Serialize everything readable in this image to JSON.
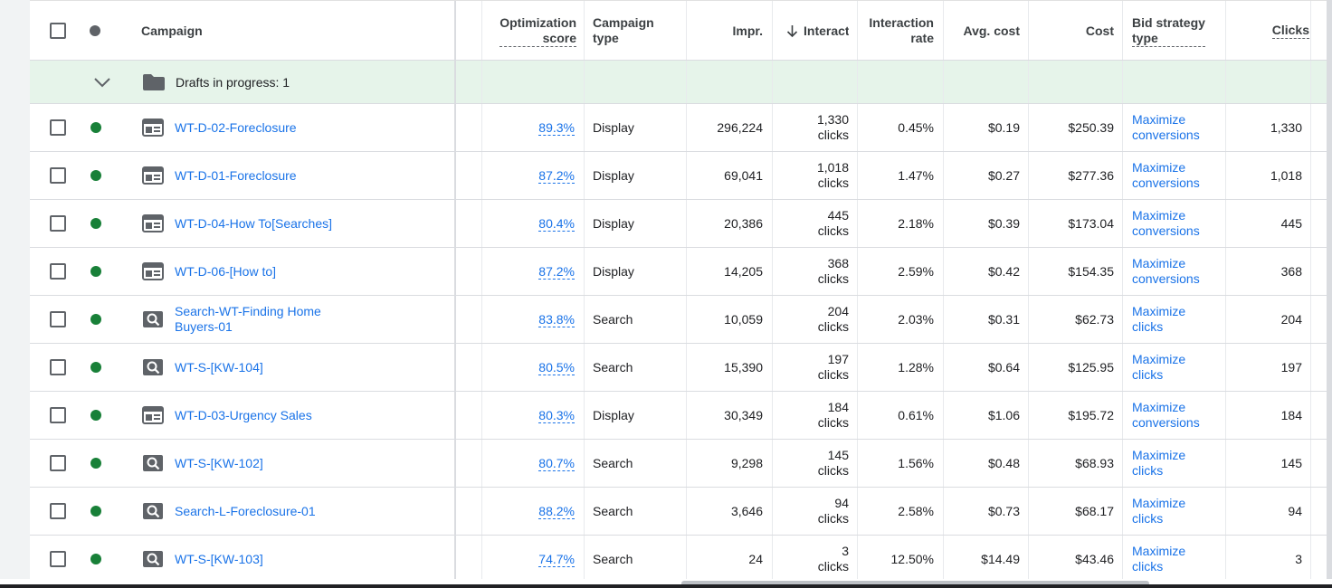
{
  "header": {
    "campaign": "Campaign",
    "opt_score_1": "Optimization",
    "opt_score_2": "score",
    "campaign_type_1": "Campaign",
    "campaign_type_2": "type",
    "impr": "Impr.",
    "interactions": "Interact",
    "interaction_rate_1": "Interaction",
    "interaction_rate_2": "rate",
    "avg_cost": "Avg. cost",
    "cost": "Cost",
    "bid_strategy_1": "Bid strategy",
    "bid_strategy_2": "type",
    "clicks": "Clicks"
  },
  "draft": {
    "label": "Drafts in progress: 1"
  },
  "colors": {
    "status_enabled": "#188038",
    "link": "#1a73e8",
    "draft_bg": "#e6f4ea"
  },
  "rows": [
    {
      "icon": "display-campaign-icon",
      "name": "WT-D-02-Foreclosure",
      "score": "89.3%",
      "type": "Display",
      "impr": "296,224",
      "inter_1": "1,330",
      "inter_2": "clicks",
      "rate": "0.45%",
      "avg": "$0.19",
      "cost": "$250.39",
      "bid_1": "Maximize",
      "bid_2": "conversions",
      "clicks": "1,330"
    },
    {
      "icon": "display-campaign-icon",
      "name": "WT-D-01-Foreclosure",
      "score": "87.2%",
      "type": "Display",
      "impr": "69,041",
      "inter_1": "1,018",
      "inter_2": "clicks",
      "rate": "1.47%",
      "avg": "$0.27",
      "cost": "$277.36",
      "bid_1": "Maximize",
      "bid_2": "conversions",
      "clicks": "1,018"
    },
    {
      "icon": "display-campaign-icon",
      "name": "WT-D-04-How To[Searches]",
      "score": "80.4%",
      "type": "Display",
      "impr": "20,386",
      "inter_1": "445",
      "inter_2": "clicks",
      "rate": "2.18%",
      "avg": "$0.39",
      "cost": "$173.04",
      "bid_1": "Maximize",
      "bid_2": "conversions",
      "clicks": "445"
    },
    {
      "icon": "display-campaign-icon",
      "name": "WT-D-06-[How to]",
      "score": "87.2%",
      "type": "Display",
      "impr": "14,205",
      "inter_1": "368",
      "inter_2": "clicks",
      "rate": "2.59%",
      "avg": "$0.42",
      "cost": "$154.35",
      "bid_1": "Maximize",
      "bid_2": "conversions",
      "clicks": "368"
    },
    {
      "icon": "search-campaign-icon",
      "name": "Search-WT-Finding Home",
      "name_2": "Buyers-01",
      "score": "83.8%",
      "type": "Search",
      "impr": "10,059",
      "inter_1": "204",
      "inter_2": "clicks",
      "rate": "2.03%",
      "avg": "$0.31",
      "cost": "$62.73",
      "bid_1": "Maximize",
      "bid_2": "clicks",
      "clicks": "204"
    },
    {
      "icon": "search-campaign-icon",
      "name": "WT-S-[KW-104]",
      "score": "80.5%",
      "type": "Search",
      "impr": "15,390",
      "inter_1": "197",
      "inter_2": "clicks",
      "rate": "1.28%",
      "avg": "$0.64",
      "cost": "$125.95",
      "bid_1": "Maximize",
      "bid_2": "clicks",
      "clicks": "197"
    },
    {
      "icon": "display-campaign-icon",
      "name": "WT-D-03-Urgency Sales",
      "score": "80.3%",
      "type": "Display",
      "impr": "30,349",
      "inter_1": "184",
      "inter_2": "clicks",
      "rate": "0.61%",
      "avg": "$1.06",
      "cost": "$195.72",
      "bid_1": "Maximize",
      "bid_2": "conversions",
      "clicks": "184"
    },
    {
      "icon": "search-campaign-icon",
      "name": "WT-S-[KW-102]",
      "score": "80.7%",
      "type": "Search",
      "impr": "9,298",
      "inter_1": "145",
      "inter_2": "clicks",
      "rate": "1.56%",
      "avg": "$0.48",
      "cost": "$68.93",
      "bid_1": "Maximize",
      "bid_2": "clicks",
      "clicks": "145"
    },
    {
      "icon": "search-campaign-icon",
      "name": "Search-L-Foreclosure-01",
      "score": "88.2%",
      "type": "Search",
      "impr": "3,646",
      "inter_1": "94",
      "inter_2": "clicks",
      "rate": "2.58%",
      "avg": "$0.73",
      "cost": "$68.17",
      "bid_1": "Maximize",
      "bid_2": "clicks",
      "clicks": "94"
    },
    {
      "icon": "search-campaign-icon",
      "name": "WT-S-[KW-103]",
      "score": "74.7%",
      "type": "Search",
      "impr": "24",
      "inter_1": "3",
      "inter_2": "clicks",
      "rate": "12.50%",
      "avg": "$14.49",
      "cost": "$43.46",
      "bid_1": "Maximize",
      "bid_2": "clicks",
      "clicks": "3"
    }
  ]
}
